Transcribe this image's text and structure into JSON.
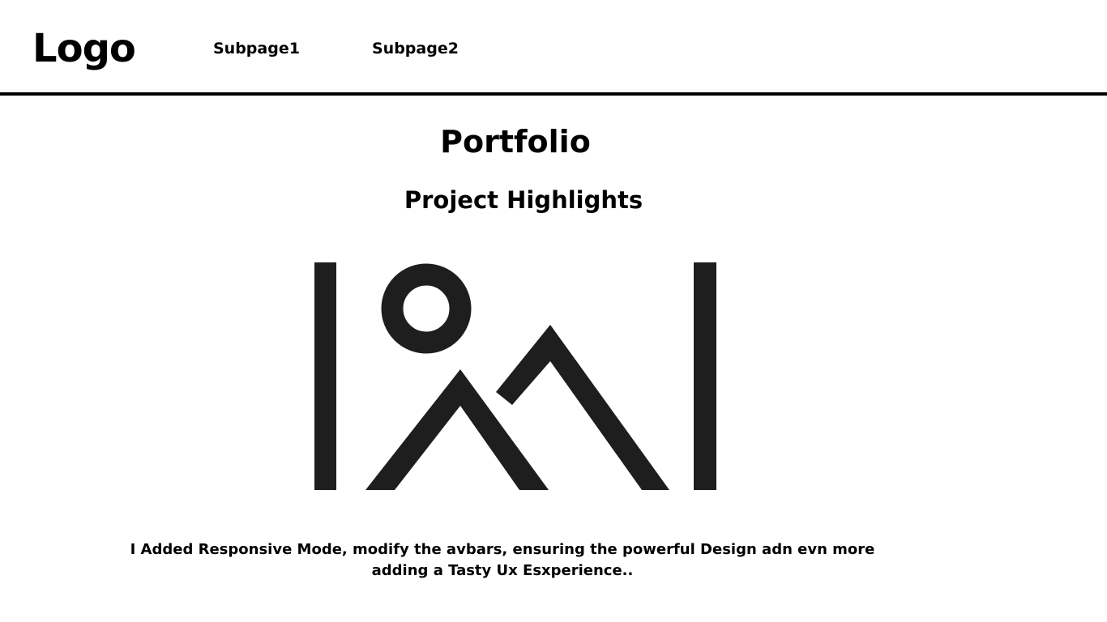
{
  "navbar": {
    "logo": "Logo",
    "links": [
      {
        "label": "Subpage1"
      },
      {
        "label": "Subpage2"
      }
    ]
  },
  "main": {
    "title": "Portfolio",
    "section_title": "Project Highlights",
    "image": {
      "icon": "image-placeholder-icon"
    },
    "description": "I Added Responsive Mode, modify the avbars, ensuring the powerful Design adn evn more adding a Tasty Ux Esxperience.."
  },
  "colors": {
    "text": "#000000",
    "icon": "#1e1e1e",
    "background": "#ffffff"
  }
}
